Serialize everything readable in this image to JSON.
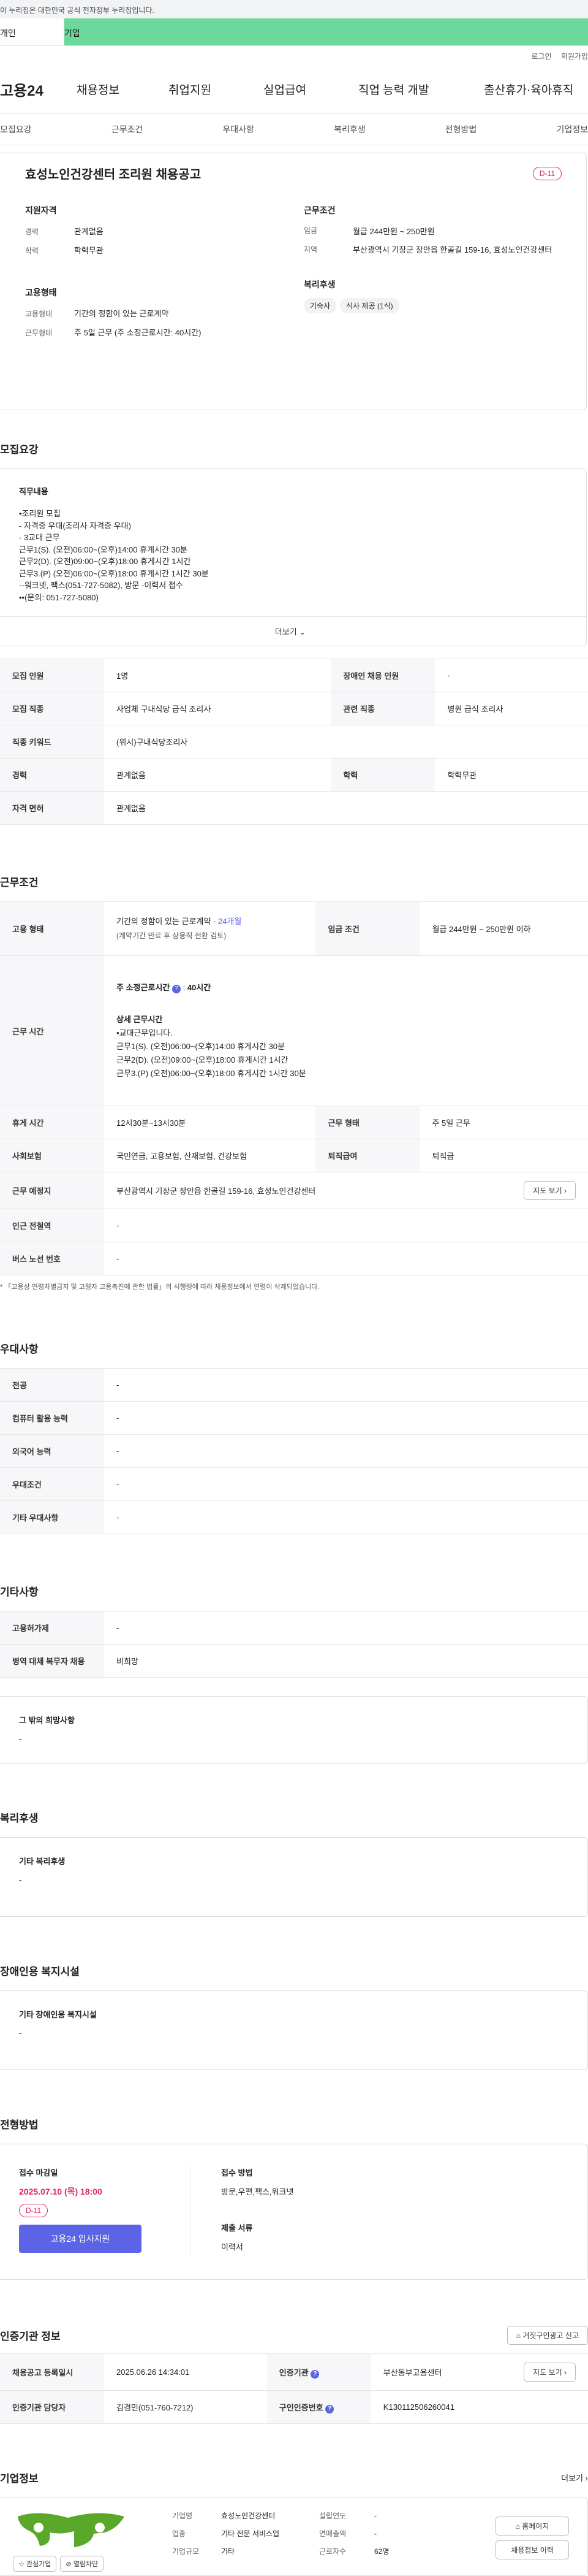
{
  "gov_banner": "이 누리집은 대한민국 공식 전자정부 누리집입니다.",
  "top_tabs": [
    "개인",
    "기업"
  ],
  "top_links": [
    "로그인",
    "회원가입"
  ],
  "gnb": {
    "logo": "고용24",
    "items": [
      "채용정보",
      "취업지원",
      "실업급여",
      "직업 능력 개발",
      "출산휴가·육아휴직"
    ]
  },
  "snb": [
    "모집요강",
    "근무조건",
    "우대사항",
    "복리후생",
    "전형방법",
    "기업정보"
  ],
  "header": {
    "title": "효성노인건강센터 조리원 채용공고",
    "dday": "D-11",
    "qual_title": "지원자격",
    "career_label": "경력",
    "career": "관계없음",
    "edu_label": "학력",
    "edu": "학력무관",
    "emp_title": "고용형태",
    "emp_type_label": "고용형태",
    "emp_type": "기간의 정함이 있는 근로계약",
    "work_form_label": "근무형태",
    "work_form": "주 5일 근무 (주 소정근로시간: 40시간)",
    "cond_title": "근무조건",
    "wage_label": "임금",
    "wage": "월급 244만원 ~ 250만원",
    "area_label": "지역",
    "area": "부산광역시 기장군 장안읍 한골길 159-16, 효성노인건강센터",
    "welfare_title": "복리후생",
    "welfare_chips": [
      "기숙사",
      "식사 제공 (1식)"
    ]
  },
  "recruit": {
    "title": "모집요강",
    "job_desc_title": "직무내용",
    "job_desc_lines": [
      "•조리원 모집",
      "- 자격증 우대(조리사 자격증 우대)",
      "- 3교대 근무",
      "근무1(S). (오전)06:00~(오후)14:00  휴게시간 30분",
      "근무2(D). (오전)09:00~(오후)18:00  휴게시간 1시간",
      "근무3.(P) (오전)06:00~(오후)18:00  휴게시간 1시간 30분",
      "--워크넷, 팩스(051-727-5082), 방문 -이력서 접수",
      "••(문의: 051-727-5080)"
    ],
    "more": "더보기",
    "rows": [
      [
        "모집 인원",
        "1명",
        "장애인 채용 인원",
        "-"
      ],
      [
        "모집 직종",
        "사업체 구내식당 급식 조리사",
        "관련 직종",
        "병원 급식 조리사"
      ],
      [
        "직종 키워드",
        "(위시)구내식당조리사",
        "",
        ""
      ],
      [
        "경력",
        "관계없음",
        "학력",
        "학력무관"
      ],
      [
        "자격 면허",
        "관계없음",
        "",
        ""
      ]
    ]
  },
  "workcond": {
    "title": "근무조건",
    "emp_label": "고용 형태",
    "emp_value": "기간의 정함이 있는 근로계약 · ",
    "emp_months": "24개월",
    "emp_note": "(계약기간 만료 후 상용직 전환 검토)",
    "wage_label": "임금 조건",
    "wage_value": "월급 244만원 ~ 250만원 이하",
    "time_label": "근무 시간",
    "time_main": "주 소정근로시간",
    "time_hours": "40시간",
    "time_detail_title": "상세 근무시간",
    "time_lines": [
      "•교대근무입니다.",
      "근무1(S). (오전)06:00~(오후)14:00  휴게시간 30분",
      "근무2(D). (오전)09:00~(오후)18:00  휴게시간 1시간",
      "근무3.(P) (오전)06:00~(오후)18:00  휴게시간 1시간 30분"
    ],
    "rows": [
      [
        "휴게 시간",
        "12시30분~13시30분",
        "근무 형태",
        "주 5일 근무"
      ],
      [
        "사회보험",
        "국민연금, 고용보험, 산재보험, 건강보험",
        "퇴직급여",
        "퇴직금"
      ]
    ],
    "place_label": "근무 예정지",
    "place": "부산광역시 기장군 장안읍 한골길 159-16, 효성노인건강센터",
    "map_btn": "지도 보기",
    "station_label": "인근 전철역",
    "station": "-",
    "bus_label": "버스 노선 번호",
    "bus": "-",
    "note": "* 「고용상 연령차별금지 및 고령자 고용촉진에 관한 법률」의 시행령에 따라 채용정보에서 연령이 삭제되었습니다."
  },
  "pref": {
    "title": "우대사항",
    "rows": [
      [
        "전공",
        "-"
      ],
      [
        "컴퓨터 활용 능력",
        "-"
      ],
      [
        "외국어 능력",
        "-"
      ],
      [
        "우대조건",
        "-"
      ],
      [
        "기타 우대사항",
        "-"
      ]
    ]
  },
  "etc": {
    "title": "기타사항",
    "rows": [
      [
        "고용허가제",
        "-"
      ],
      [
        "병역 대체 복무자 채용",
        "비희망"
      ]
    ],
    "other_title": "그 밖의 희망사항",
    "other": "-"
  },
  "welfare": {
    "title": "복리후생",
    "sub": "기타 복리후생",
    "value": "-"
  },
  "disabled": {
    "title": "장애인용 복지시설",
    "sub": "기타 장애인용 복지시설",
    "value": "-"
  },
  "process": {
    "title": "전형방법",
    "deadline_label": "접수 마감일",
    "deadline": "2025.07.10 (목) 18:00",
    "dday": "D-11",
    "apply_btn": "고용24 입사지원",
    "method_label": "접수 방법",
    "method": "방문,우편,팩스,워크넷",
    "docs_label": "제출 서류",
    "docs": "이력서"
  },
  "agency": {
    "title": "인증기관 정보",
    "report_btn": "거짓구인광고 신고",
    "reg_label": "채용공고 등록일시",
    "reg": "2025.06.26 14:34:01",
    "agency_label": "인증기관",
    "agency": "부산동부고용센터",
    "map_btn": "지도 보기",
    "manager_label": "인증기관 담당자",
    "manager": "김경민(051-760-7212)",
    "auth_label": "구인인증번호",
    "auth": "K130112506260041"
  },
  "company": {
    "title": "기업정보",
    "more": "더보기",
    "fav_btn": "관심기업",
    "block_btn": "열람차단",
    "cols": [
      [
        [
          "기업명",
          "효성노인건강센터"
        ],
        [
          "업종",
          "기타 전문 서비스업"
        ],
        [
          "기업규모",
          "기타"
        ]
      ],
      [
        [
          "설립연도",
          "-"
        ],
        [
          "연매출액",
          "-"
        ],
        [
          "근로자수",
          "62명"
        ]
      ]
    ],
    "home_btn": "홈페이지",
    "jobs_btn": "채용정보 이력"
  },
  "colors": {
    "accent": "#5b63e6",
    "green": "#6bd89c",
    "pink": "#e0245e"
  }
}
